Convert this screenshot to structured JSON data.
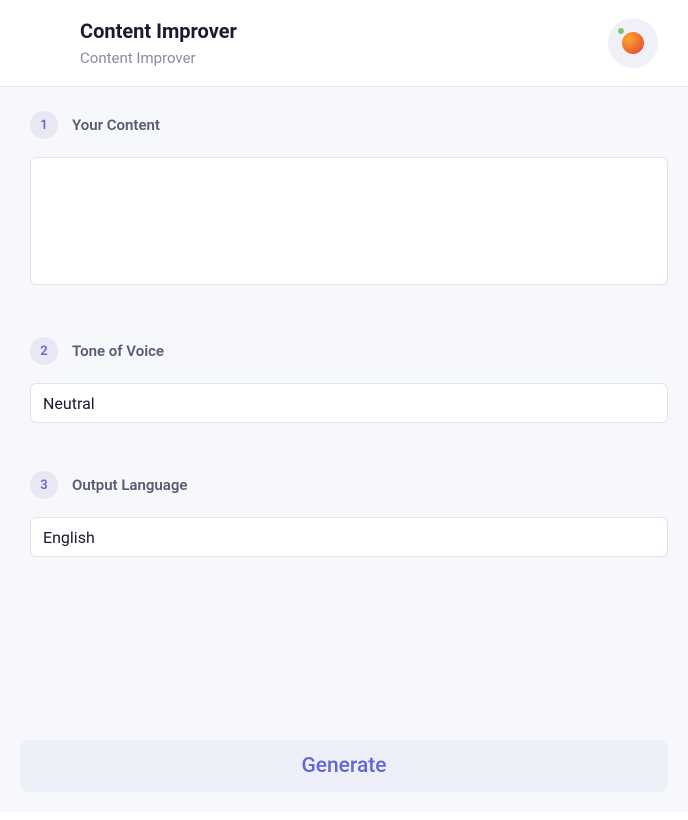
{
  "header": {
    "title": "Content Improver",
    "subtitle": "Content Improver"
  },
  "sections": [
    {
      "step": "1",
      "label": "Your Content",
      "type": "textarea",
      "value": ""
    },
    {
      "step": "2",
      "label": "Tone of Voice",
      "type": "text",
      "value": "Neutral"
    },
    {
      "step": "3",
      "label": "Output Language",
      "type": "text",
      "value": "English"
    }
  ],
  "actions": {
    "generate_label": "Generate"
  }
}
